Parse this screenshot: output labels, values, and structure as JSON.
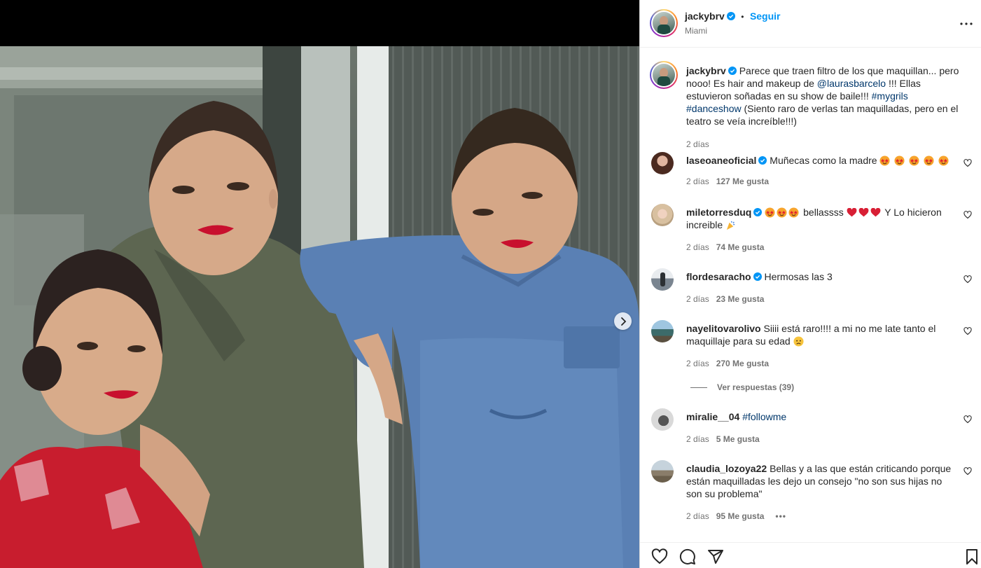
{
  "post": {
    "author": "jackybrv",
    "follow_label": "Seguir",
    "separator": "•",
    "location": "Miami"
  },
  "caption": {
    "username": "jackybrv",
    "text_1": "Parece que traen filtro de los que maquillan... pero nooo! Es hair and makeup de ",
    "mention": "@laurasbarcelo",
    "text_2": " !!! Ellas estuvieron soñadas en su show de baile!!! ",
    "hashtag_1": "#mygrils",
    "hashtag_2": "#danceshow",
    "text_3": " (Siento raro de verlas tan maquilladas, pero en el teatro se veía increíble!!!)",
    "time": "2 días"
  },
  "comments": [
    {
      "username": "laseoaneoficial",
      "text": "Muñecas como la madre",
      "time": "2 días",
      "likes": "127 Me gusta"
    },
    {
      "username": "miletorresduq",
      "text_1": "bellassss",
      "text_2": "Y Lo hicieron increible",
      "time": "2 días",
      "likes": "74 Me gusta"
    },
    {
      "username": "flordesaracho",
      "text": "Hermosas las 3",
      "time": "2 días",
      "likes": "23 Me gusta"
    },
    {
      "username": "nayelitovarolivo",
      "text": "Siiii está raro!!!! a mi no me late tanto el maquillaje para su edad",
      "time": "2 días",
      "likes": "270 Me gusta"
    },
    {
      "username": "miralie__04",
      "hashtag": "#followme",
      "time": "2 días",
      "likes": "5 Me gusta"
    },
    {
      "username": "claudia_lozoya22",
      "text": "Bellas y a las que están criticando porque están maquilladas les dejo un consejo \"no son sus hijas no son su problema\"",
      "time": "2 días",
      "likes": "95 Me gusta",
      "more": "•••"
    }
  ],
  "view_replies": "Ver respuestas (39)",
  "icons": [
    "verified-badge-icon",
    "more-options-icon",
    "heart-icon",
    "comment-icon",
    "share-icon",
    "bookmark-icon",
    "chevron-right-icon"
  ],
  "colors": {
    "link": "#0095f6",
    "mention": "#00376b",
    "meta": "#737373"
  }
}
